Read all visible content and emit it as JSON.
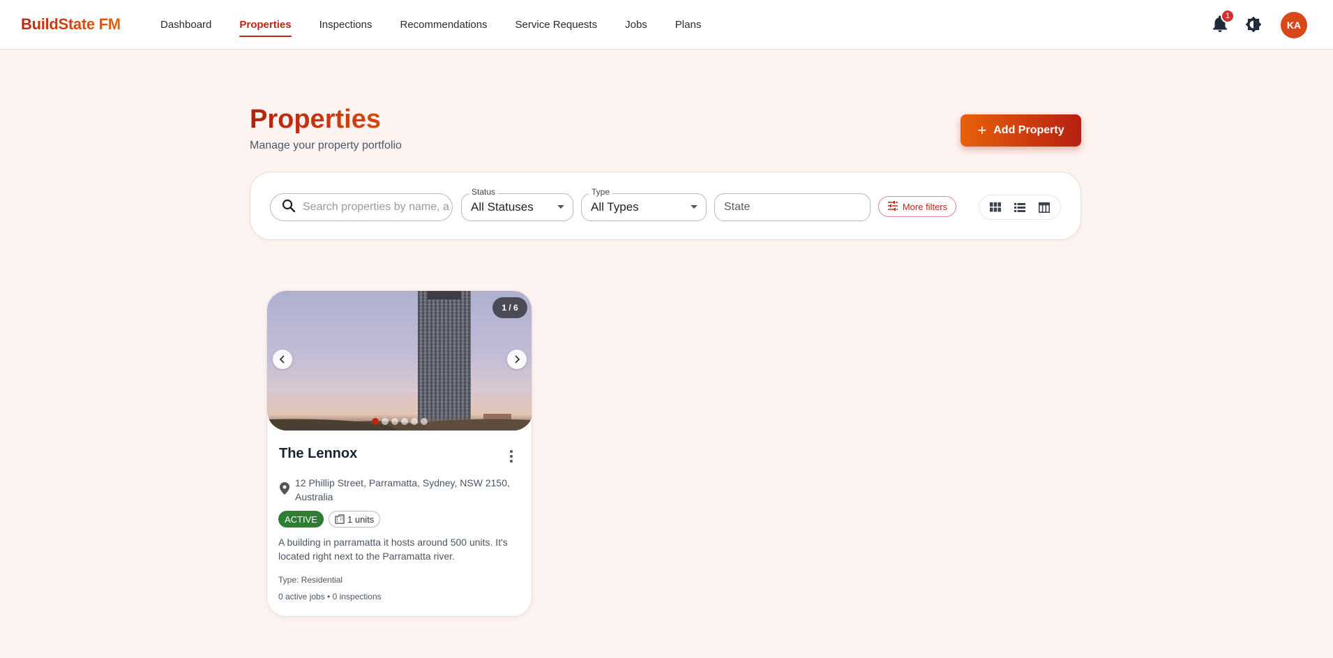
{
  "app": {
    "brand": "BuildState FM"
  },
  "nav": {
    "items": [
      {
        "label": "Dashboard",
        "active": false
      },
      {
        "label": "Properties",
        "active": true
      },
      {
        "label": "Inspections",
        "active": false
      },
      {
        "label": "Recommendations",
        "active": false
      },
      {
        "label": "Service Requests",
        "active": false
      },
      {
        "label": "Jobs",
        "active": false
      },
      {
        "label": "Plans",
        "active": false
      }
    ],
    "notification_count": "1",
    "avatar_initials": "KA"
  },
  "header": {
    "title": "Properties",
    "subtitle": "Manage your property portfolio",
    "add_button_label": "Add Property"
  },
  "filters": {
    "search_placeholder": "Search properties by name, address...",
    "status_label": "Status",
    "status_value": "All Statuses",
    "type_label": "Type",
    "type_value": "All Types",
    "state_placeholder": "State",
    "more_filters_label": "More filters",
    "view_modes": [
      "grid-view-icon",
      "list-view-icon",
      "table-view-icon"
    ]
  },
  "properties": [
    {
      "name": "The Lennox",
      "photo_counter": "1 / 6",
      "photo_count": 6,
      "active_photo": 1,
      "address": "12 Phillip Street, Parramatta, Sydney, NSW 2150, Australia",
      "status": "ACTIVE",
      "units": "1 units",
      "description": "A building in parramatta it hosts around 500 units. It's located right next to the Parramatta river.",
      "type": "Type: Residential",
      "meta": "0 active jobs • 0 inspections"
    }
  ],
  "colors": {
    "brand": "#c0260f",
    "accent_orange": "#e8610a",
    "status_active": "#2e7d32",
    "page_bg": "#fdf3f1"
  }
}
